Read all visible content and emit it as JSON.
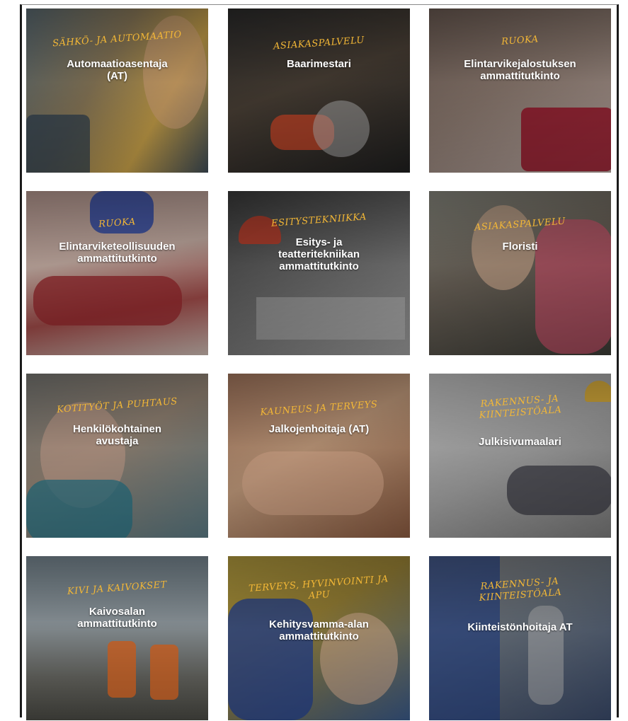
{
  "tiles": [
    {
      "category": "Sähkö- ja automaatio",
      "title": "Automaatioasentaja\n(AT)"
    },
    {
      "category": "Asiakaspalvelu",
      "title": "Baarimestari"
    },
    {
      "category": "Ruoka",
      "title": "Elintarvikejalostuksen\nammattitutkinto"
    },
    {
      "category": "Ruoka",
      "title": "Elintarviketeollisuuden\nammattitutkinto"
    },
    {
      "category": "Esitystekniikka",
      "title": "Esitys- ja\nteatteritekniikan\nammattitutkinto"
    },
    {
      "category": "Asiakaspalvelu",
      "title": "Floristi"
    },
    {
      "category": "Kotityöt ja puhtaus",
      "title": "Henkilökohtainen\navustaja"
    },
    {
      "category": "Kauneus ja terveys",
      "title": "Jalkojenhoitaja (AT)"
    },
    {
      "category": "Rakennus- ja\nkiinteistöala",
      "title": "Julkisivumaalari"
    },
    {
      "category": "Kivi ja kaivokset",
      "title": "Kaivosalan\nammattitutkinto"
    },
    {
      "category": "Terveys, hyvinvointi ja\napu",
      "title": "Kehitysvamma-alan\nammattitutkinto"
    },
    {
      "category": "Rakennus- ja\nkiinteistöala",
      "title": "Kiinteistönhoitaja AT"
    }
  ],
  "colors": {
    "accent": "#f4b836",
    "title_text": "#ffffff"
  }
}
